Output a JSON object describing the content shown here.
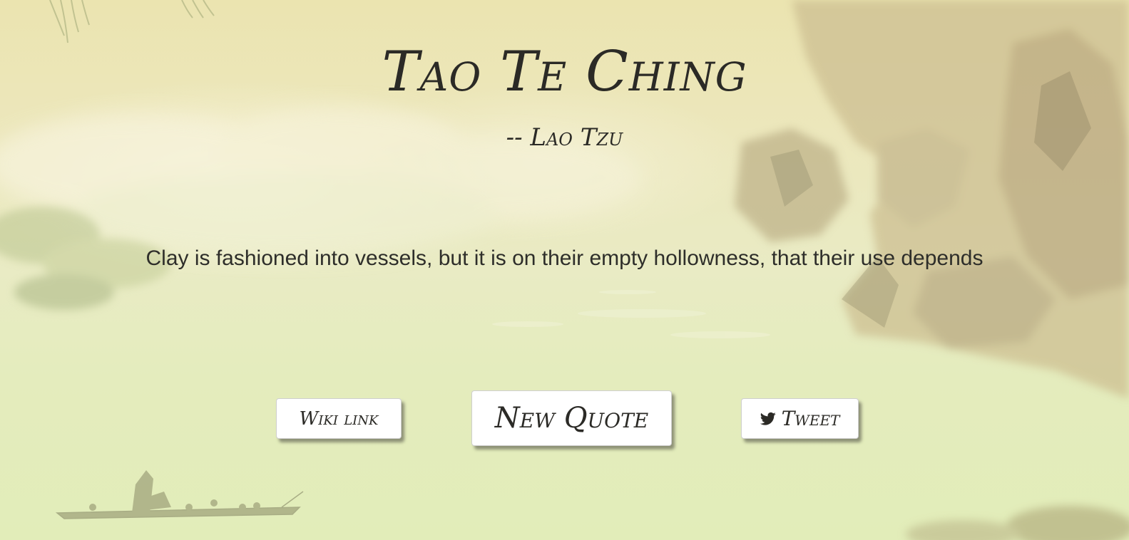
{
  "title": "Tao Te Ching",
  "author": "-- Lao Tzu",
  "quote": "Clay is fashioned into vessels, but it is on their empty hollowness, that their use depends",
  "buttons": {
    "wiki_label": "Wiki link",
    "new_quote_label": "New Quote",
    "tweet_label": "Tweet",
    "tweet_icon": "twitter-bird-icon"
  },
  "colors": {
    "text": "#2b2a26",
    "button_bg": "#ffffff"
  }
}
